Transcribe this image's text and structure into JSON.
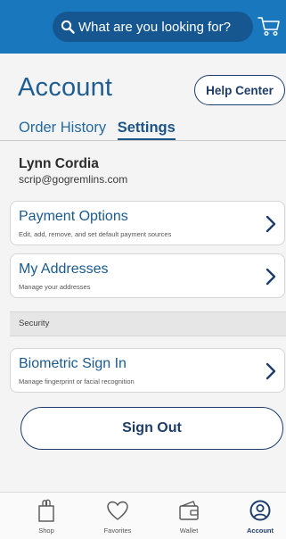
{
  "search": {
    "placeholder": "What are you looking for?",
    "icon": "search-icon"
  },
  "header": {
    "cart_icon": "cart-icon"
  },
  "page": {
    "title": "Account",
    "help_button": "Help Center",
    "tabs": [
      {
        "label": "Order History",
        "active": false
      },
      {
        "label": "Settings",
        "active": true
      }
    ]
  },
  "user": {
    "name": "Lynn Cordia",
    "email": "scrip@gogremlins.com"
  },
  "cards": [
    {
      "title": "Payment Options",
      "subtitle": "Edit, add, remove, and set default payment sources"
    },
    {
      "title": "My Addresses",
      "subtitle": "Manage your addresses"
    },
    {
      "title": "Biometric Sign In",
      "subtitle": "Manage fingerprint or facial recognition"
    }
  ],
  "security_section": {
    "label": "Security"
  },
  "sign_out_label": "Sign Out",
  "nav": [
    {
      "label": "Shop",
      "icon": "bag-icon",
      "active": false
    },
    {
      "label": "Favorites",
      "icon": "heart-icon",
      "active": false
    },
    {
      "label": "Wallet",
      "icon": "wallet-icon",
      "active": false
    },
    {
      "label": "Account",
      "icon": "account-icon",
      "active": true
    }
  ],
  "colors": {
    "header_blue": "#1977bd",
    "search_bg": "#165791",
    "link_blue": "#1b5a91",
    "navy": "#1e3d6a"
  }
}
